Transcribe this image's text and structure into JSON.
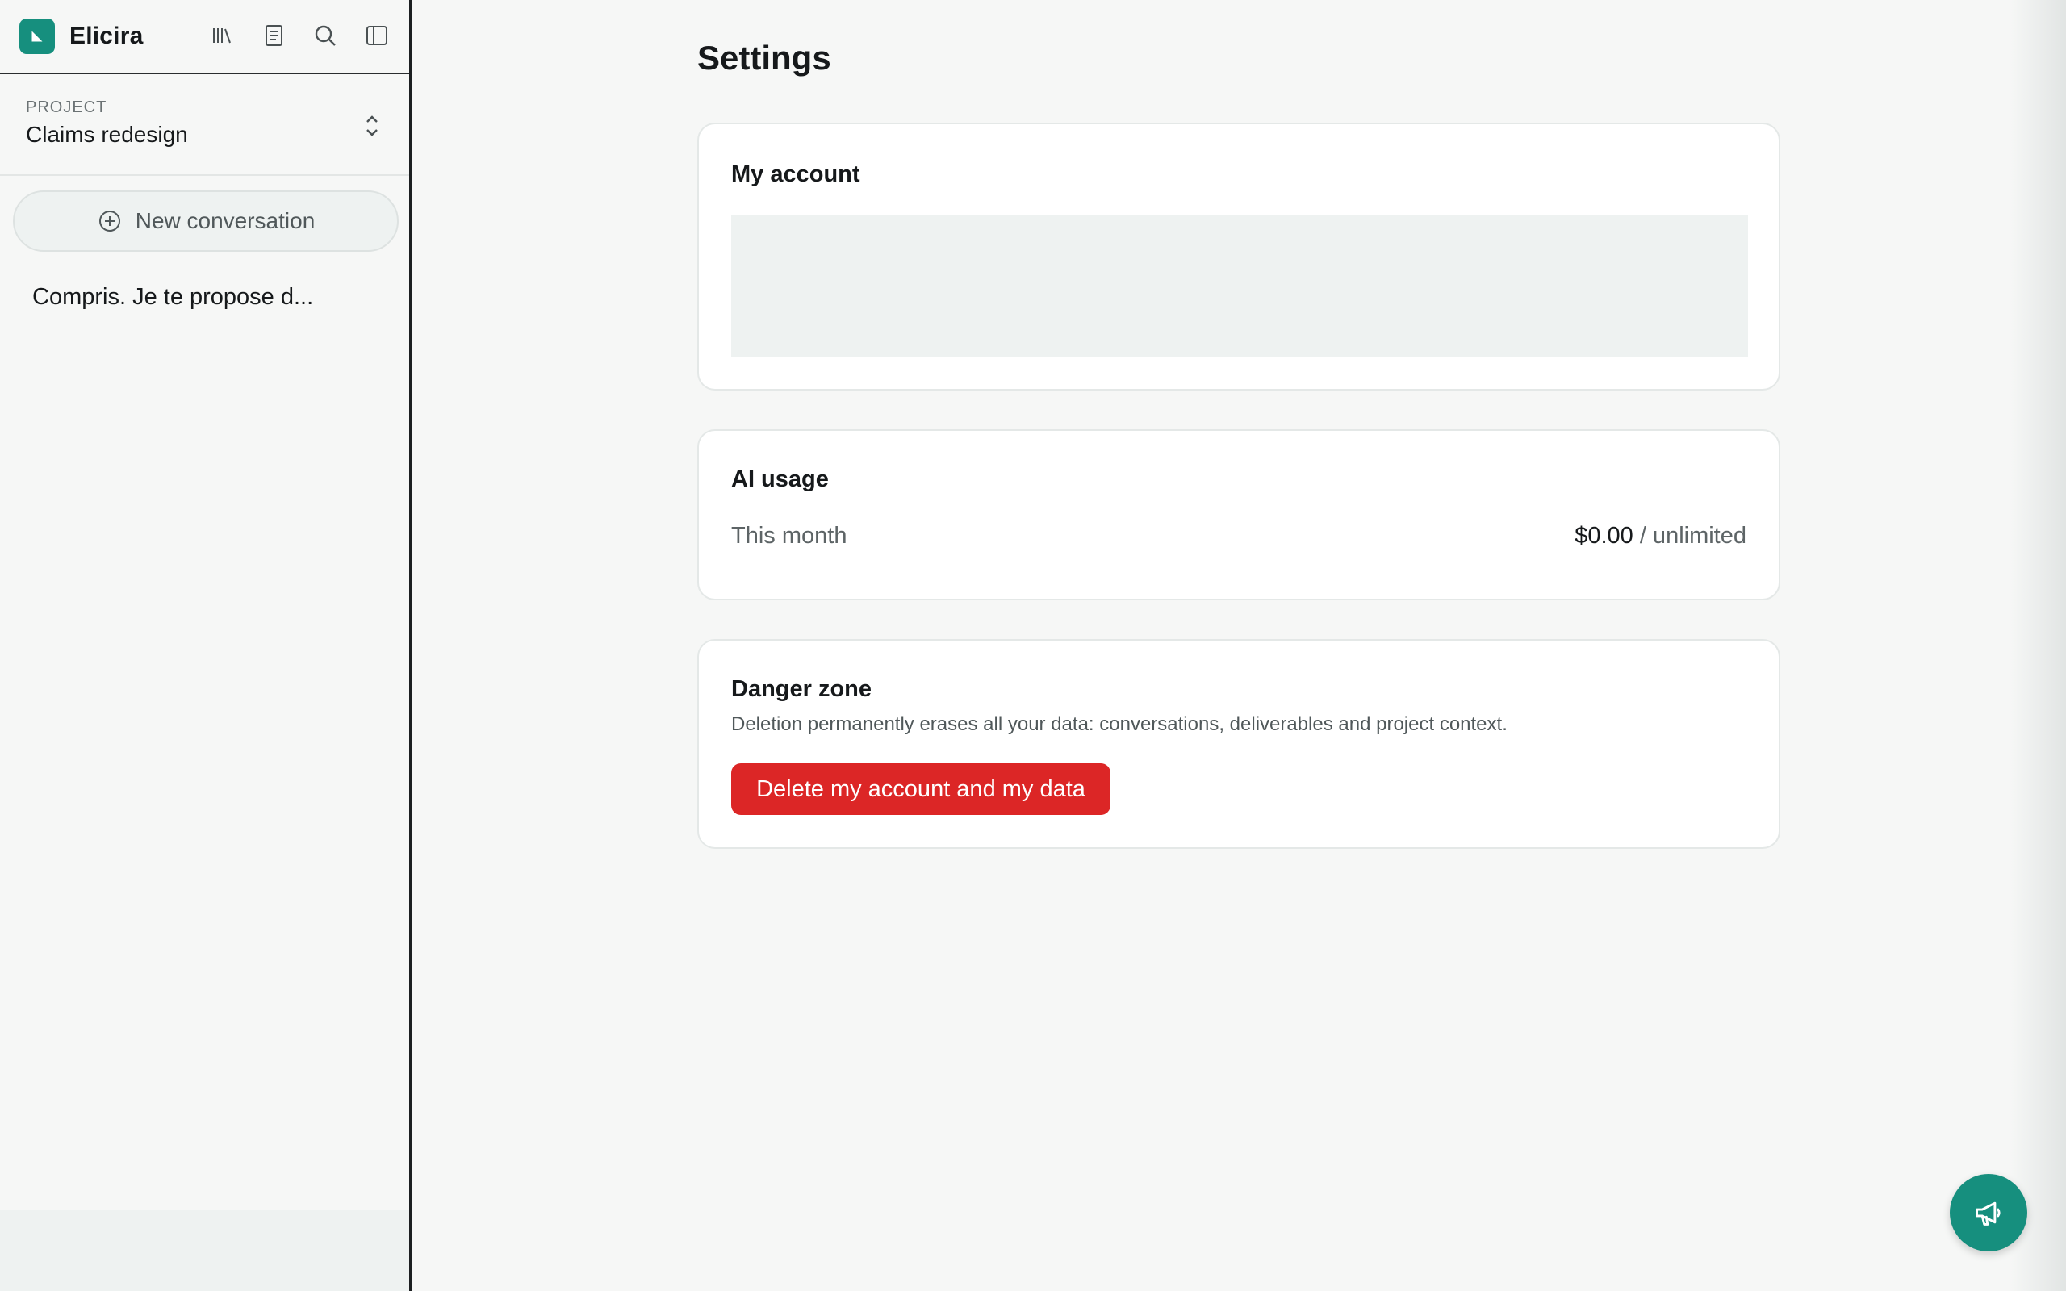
{
  "app": {
    "name": "Elicira"
  },
  "topbar": {
    "icons": [
      "library-icon",
      "notebook-icon",
      "search-icon",
      "sidebar-toggle-icon"
    ]
  },
  "project": {
    "label": "PROJECT",
    "name": "Claims redesign"
  },
  "sidebar": {
    "new_conversation_label": "New conversation",
    "conversations": [
      {
        "title": "Compris. Je te propose d..."
      }
    ]
  },
  "settings": {
    "title": "Settings",
    "account": {
      "title": "My account"
    },
    "ai_usage": {
      "title": "AI usage",
      "period_label": "This month",
      "amount": "$0.00",
      "limit": " / unlimited"
    },
    "danger_zone": {
      "title": "Danger zone",
      "description": "Deletion permanently erases all your data: conversations, deliverables and project context.",
      "delete_label": "Delete my account and my data"
    }
  },
  "colors": {
    "brand": "#168f7e",
    "danger": "#dc2626"
  }
}
